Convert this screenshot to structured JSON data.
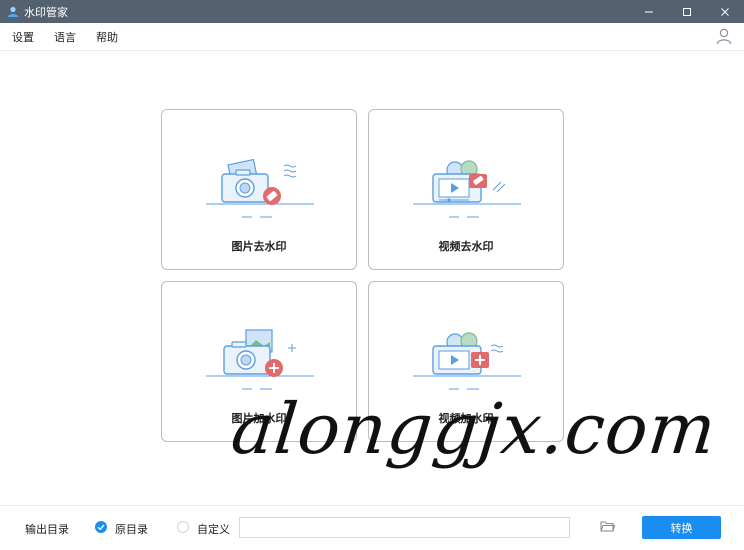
{
  "window": {
    "title": "水印管家"
  },
  "menu": {
    "items": [
      "设置",
      "语言",
      "帮助"
    ]
  },
  "cards": [
    {
      "label": "图片去水印"
    },
    {
      "label": "视频去水印"
    },
    {
      "label": "图片加水印"
    },
    {
      "label": "视频加水印"
    }
  ],
  "watermark": {
    "text": "alonggjx.com"
  },
  "footer": {
    "output_label": "输出目录",
    "option_original": "原目录",
    "option_custom": "自定义",
    "path_value": "",
    "convert_label": "转换"
  },
  "colors": {
    "titlebar": "#546170",
    "accent": "#1a8ef0",
    "icon_blue": "#5b9ee0",
    "icon_red": "#e26a6a",
    "icon_green": "#7dbb8e"
  }
}
